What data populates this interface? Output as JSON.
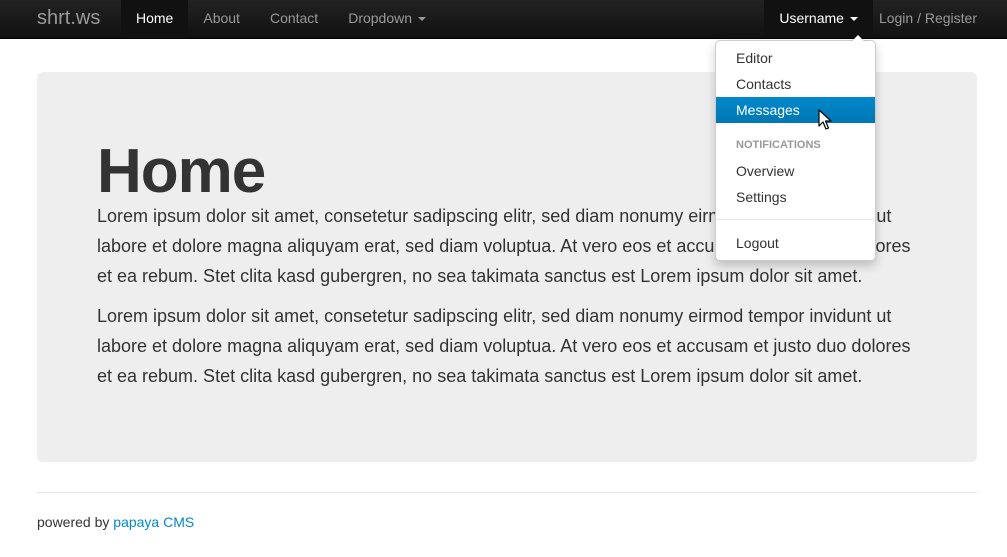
{
  "navbar": {
    "brand": "shrt.ws",
    "left_items": [
      {
        "label": "Home"
      },
      {
        "label": "About"
      },
      {
        "label": "Contact"
      },
      {
        "label": "Dropdown"
      }
    ],
    "right_items": [
      {
        "label": "Username"
      },
      {
        "label": "Login / Register"
      }
    ]
  },
  "dropdown": {
    "items": [
      {
        "label": "Editor"
      },
      {
        "label": "Contacts"
      },
      {
        "label": "Messages"
      }
    ],
    "header": "NOTIFICATIONS",
    "notification_items": [
      {
        "label": "Overview"
      },
      {
        "label": "Settings"
      }
    ],
    "logout": "Logout"
  },
  "hero": {
    "title": "Home",
    "paragraphs": [
      "Lorem ipsum dolor sit amet, consetetur sadipscing elitr, sed diam nonumy eirmod tempor invidunt ut labore et dolore magna aliquyam erat, sed diam voluptua. At vero eos et accusam et justo duo dolores et ea rebum. Stet clita kasd gubergren, no sea takimata sanctus est Lorem ipsum dolor sit amet.",
      "Lorem ipsum dolor sit amet, consetetur sadipscing elitr, sed diam nonumy eirmod tempor invidunt ut labore et dolore magna aliquyam erat, sed diam voluptua. At vero eos et accusam et justo duo dolores et ea rebum. Stet clita kasd gubergren, no sea takimata sanctus est Lorem ipsum dolor sit amet."
    ]
  },
  "footer": {
    "prefix": "powered by",
    "link": "papaya CMS"
  },
  "colors": {
    "navbar": "#1b1b1b",
    "accent": "#0088cc",
    "hero_bg": "#eeeeee"
  }
}
